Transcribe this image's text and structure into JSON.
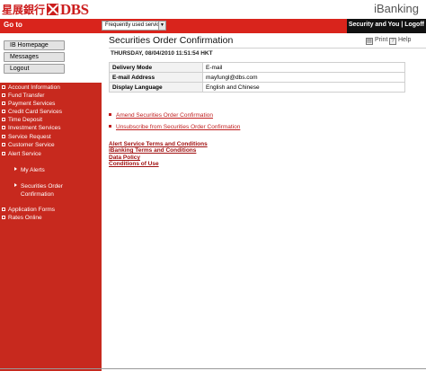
{
  "header": {
    "logo_chinese": "星展銀行",
    "logo_text": "DBS",
    "brand_title": "iBanking"
  },
  "toolbar": {
    "goto_label": "Go to",
    "service_select_value": "Frequently used services ...",
    "security_text": "Security and You | Logoff"
  },
  "sidebar": {
    "buttons": [
      "IB Homepage",
      "Messages",
      "Logout"
    ],
    "nav": [
      "Account Information",
      "Fund Transfer",
      "Payment Services",
      "Credit Card Services",
      "Time Deposit",
      "Investment Services",
      "Service Request",
      "Customer Service",
      "Alert Service"
    ],
    "alert_sub": [
      "My Alerts",
      "Securities Order",
      "Confirmation"
    ],
    "nav_bottom": [
      "Application Forms",
      "Rates Online"
    ]
  },
  "main": {
    "title": "Securities Order Confirmation",
    "print_label": "Print",
    "help_label": "Help",
    "timestamp": "THURSDAY, 08/04/2010 11:51:54 HKT",
    "rows": [
      {
        "label": "Delivery Mode",
        "value": "E-mail"
      },
      {
        "label": "E-mail Address",
        "value": "mayfungl@dbs.com"
      },
      {
        "label": "Display Language",
        "value": "English and Chinese"
      }
    ],
    "actions": [
      "Amend Securities Order Confirmation",
      "Unsubscribe from Securities Order Confirmation"
    ],
    "footer_links": [
      "Alert Service Terms and Conditions",
      "iBanking Terms and Conditions",
      "Data Policy",
      "Conditions of Use"
    ]
  },
  "colors": {
    "brand_red": "#d9241c",
    "sidebar_red": "#c7291e",
    "link_red": "#c01d1d"
  }
}
